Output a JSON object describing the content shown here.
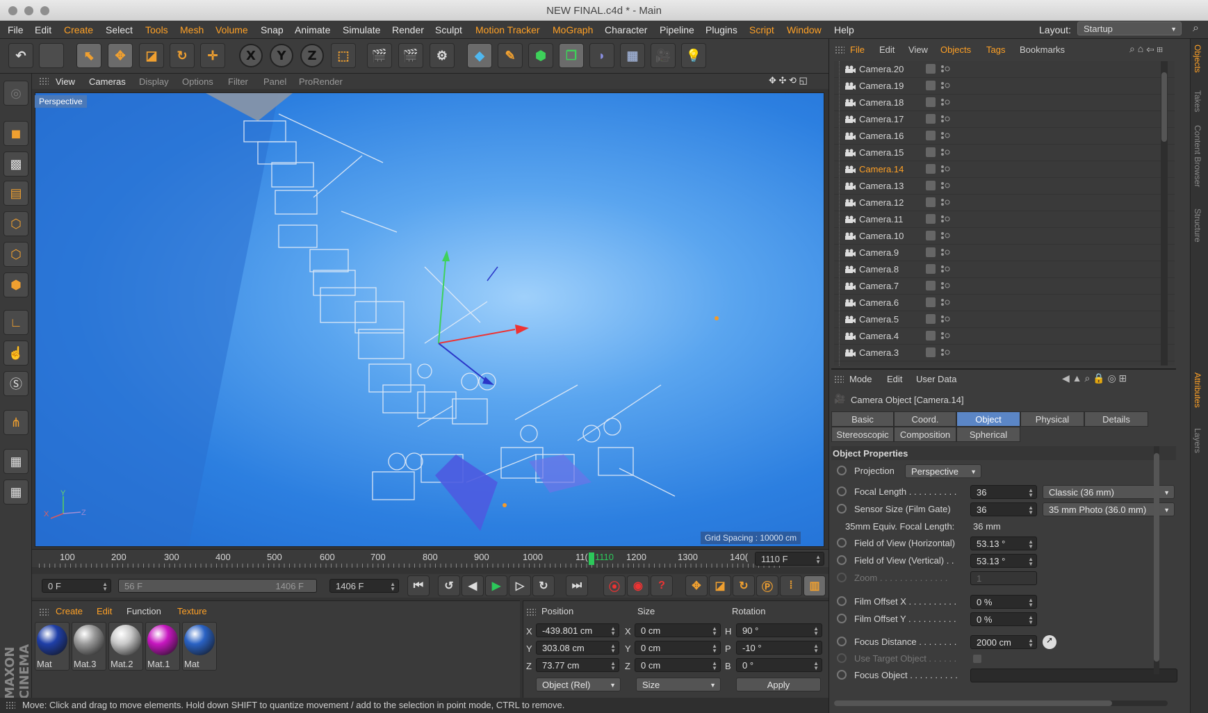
{
  "window": {
    "title": "NEW FINAL.c4d * - Main"
  },
  "menubar": {
    "items": [
      "File",
      "Edit",
      "Create",
      "Select",
      "Tools",
      "Mesh",
      "Volume",
      "Snap",
      "Animate",
      "Simulate",
      "Render",
      "Sculpt",
      "Motion Tracker",
      "MoGraph",
      "Character",
      "Pipeline",
      "Plugins",
      "Script",
      "Window",
      "Help"
    ],
    "layout_label": "Layout:",
    "layout_value": "Startup"
  },
  "toolbar": {
    "axis_x": "X",
    "axis_y": "Y",
    "axis_z": "Z"
  },
  "viewport": {
    "menu": [
      "View",
      "Cameras",
      "Display",
      "Options",
      "Filter",
      "Panel",
      "ProRender"
    ],
    "label": "Perspective",
    "grid_spacing": "Grid Spacing : 10000 cm",
    "axis_x": "X",
    "axis_y": "Y",
    "axis_z": "Z"
  },
  "timeline": {
    "ticks": [
      "100",
      "200",
      "300",
      "400",
      "500",
      "600",
      "700",
      "800",
      "900",
      "1000",
      "11(",
      "1110",
      "1200",
      "1300",
      "140("
    ],
    "current": "1110",
    "end_field": "1110 F"
  },
  "timecontrols": {
    "start": "0 F",
    "range_left": "56 F",
    "range_right": "1406 F",
    "end": "1406 F"
  },
  "materials": {
    "menu": [
      "Create",
      "Edit",
      "Function",
      "Texture"
    ],
    "items": [
      {
        "name": "Mat",
        "color": "#1f3fa8"
      },
      {
        "name": "Mat.3",
        "color": "#9a9a9a"
      },
      {
        "name": "Mat.2",
        "color": "#c9c9c9"
      },
      {
        "name": "Mat.1",
        "color": "#c716c0"
      },
      {
        "name": "Mat",
        "color": "#2a62c4"
      }
    ]
  },
  "coords": {
    "headers": [
      "Position",
      "Size",
      "Rotation"
    ],
    "rows": [
      {
        "axis": "X",
        "pos": "-439.801 cm",
        "saxis": "X",
        "size": "0 cm",
        "raxis": "H",
        "rot": "90 °"
      },
      {
        "axis": "Y",
        "pos": "303.08 cm",
        "saxis": "Y",
        "size": "0 cm",
        "raxis": "P",
        "rot": "-10 °"
      },
      {
        "axis": "Z",
        "pos": "73.77 cm",
        "saxis": "Z",
        "size": "0 cm",
        "raxis": "B",
        "rot": "0 °"
      }
    ],
    "mode": "Object (Rel)",
    "size_mode": "Size",
    "apply": "Apply"
  },
  "status": {
    "text": "Move: Click and drag to move elements. Hold down SHIFT to quantize movement / add to the selection in point mode, CTRL to remove."
  },
  "objects": {
    "menu": [
      "File",
      "Edit",
      "View",
      "Objects",
      "Tags",
      "Bookmarks"
    ],
    "items": [
      "Camera.20",
      "Camera.19",
      "Camera.18",
      "Camera.17",
      "Camera.16",
      "Camera.15",
      "Camera.14",
      "Camera.13",
      "Camera.12",
      "Camera.11",
      "Camera.10",
      "Camera.9",
      "Camera.8",
      "Camera.7",
      "Camera.6",
      "Camera.5",
      "Camera.4",
      "Camera.3"
    ],
    "selected": "Camera.14"
  },
  "attributes": {
    "menu": [
      "Mode",
      "Edit",
      "User Data"
    ],
    "title": "Camera Object [Camera.14]",
    "tabs_row1": [
      "Basic",
      "Coord.",
      "Object",
      "Physical",
      "Details"
    ],
    "tabs_row2": [
      "Stereoscopic",
      "Composition",
      "Spherical"
    ],
    "active_tab": "Object",
    "section": "Object Properties",
    "projection_label": "Projection",
    "projection_value": "Perspective",
    "focal_length_label": "Focal Length . . . . . . . . . .",
    "focal_length_value": "36",
    "focal_length_preset": "Classic (36 mm)",
    "sensor_label": "Sensor Size (Film Gate)",
    "sensor_value": "36",
    "sensor_preset": "35 mm Photo (36.0 mm)",
    "equiv_label": "35mm Equiv. Focal Length:",
    "equiv_value": "36 mm",
    "fov_h_label": "Field of View (Horizontal)",
    "fov_h_value": "53.13 °",
    "fov_v_label": "Field of View (Vertical) . .",
    "fov_v_value": "53.13 °",
    "zoom_label": "Zoom . . . . . . . . . . . . . .",
    "zoom_value": "1",
    "offset_x_label": "Film Offset X . . . . . . . . . .",
    "offset_x_value": "0 %",
    "offset_y_label": "Film Offset Y . . . . . . . . . .",
    "offset_y_value": "0 %",
    "focus_dist_label": "Focus Distance . . . . . . . .",
    "focus_dist_value": "2000 cm",
    "use_target_label": "Use Target Object . . . . . .",
    "focus_object_label": "Focus Object . . . . . . . . . ."
  },
  "side_tabs": [
    "Objects",
    "Takes",
    "Content Browser",
    "Structure",
    "Attributes",
    "Layers"
  ],
  "brand": "MAXON CINEMA 4D"
}
